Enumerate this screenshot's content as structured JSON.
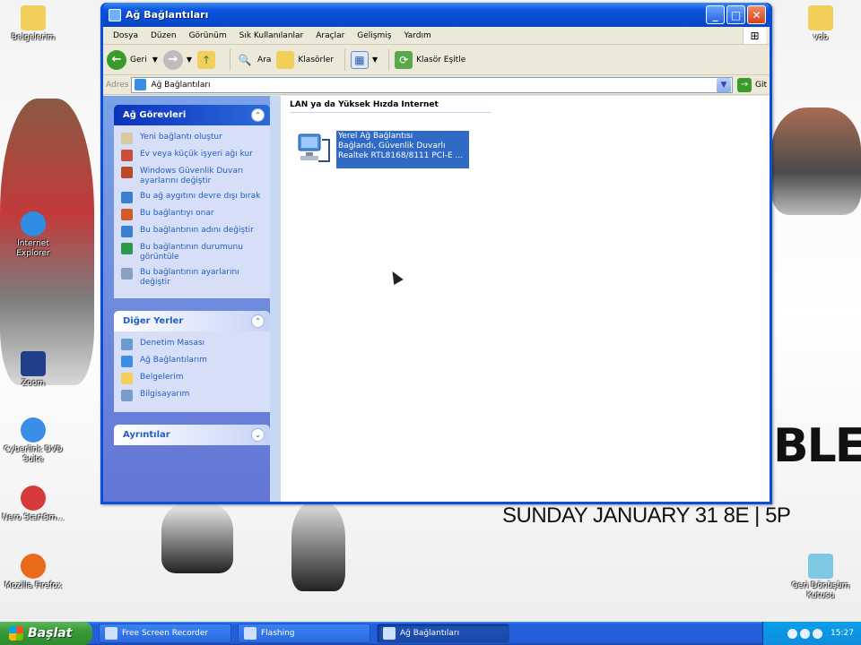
{
  "window": {
    "title": "Ağ Bağlantıları",
    "menu": [
      "Dosya",
      "Düzen",
      "Görünüm",
      "Sık Kullanılanlar",
      "Araçlar",
      "Gelişmiş",
      "Yardım"
    ],
    "toolbar": {
      "back": "Geri",
      "search": "Ara",
      "folders": "Klasörler",
      "sync": "Klasör Eşitle"
    },
    "address": {
      "label": "Adres",
      "value": "Ağ Bağlantıları",
      "go": "Git"
    }
  },
  "tasks_panel": {
    "title": "Ağ Görevleri",
    "items": [
      "Yeni bağlantı oluştur",
      "Ev veya küçük işyeri ağı kur",
      "Windows Güvenlik Duvarı ayarlarını değiştir",
      "Bu ağ aygıtını devre dışı bırak",
      "Bu bağlantıyı onar",
      "Bu bağlantının adını değiştir",
      "Bu bağlantının durumunu görüntüle",
      "Bu bağlantının ayarlarını değiştir"
    ]
  },
  "places_panel": {
    "title": "Diğer Yerler",
    "items": [
      "Denetim Masası",
      "Ağ Bağlantılarım",
      "Belgelerim",
      "Bilgisayarım"
    ]
  },
  "details_panel": {
    "title": "Ayrıntılar"
  },
  "main": {
    "group_header": "LAN ya da Yüksek Hızda Internet",
    "connection": {
      "name": "Yerel Ağ Bağlantısı",
      "status": "Bağlandı, Güvenlik Duvarlı",
      "device": "Realtek RTL8168/8111 PCI-E ..."
    }
  },
  "desktop": {
    "icons_left": [
      "Belgelerim",
      "Internet Explorer",
      "Zoom",
      "Cyberlink DVD Suite",
      "Nero StartSm...",
      "Mozilla Firefox"
    ],
    "icons_right": [
      "vob",
      "Geri Dönüşüm Kutusu"
    ],
    "promo_line1": "BLE",
    "promo_line2": "SUNDAY JANUARY 31 8E | 5P"
  },
  "taskbar": {
    "start": "Başlat",
    "tasks": [
      "Free Screen Recorder",
      "Flashing",
      "Ağ Bağlantıları"
    ],
    "clock": "15:27"
  },
  "colors": {
    "xp_blue": "#0a4fd8",
    "selection": "#316ac5",
    "task_link": "#215dc6"
  }
}
